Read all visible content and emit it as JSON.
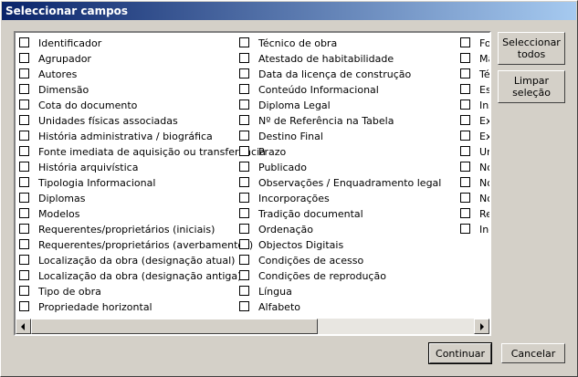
{
  "window": {
    "title": "Seleccionar campos"
  },
  "fields": {
    "col1": [
      "Identificador",
      "Agrupador",
      "Autores",
      "Dimensão",
      "Cota do documento",
      "Unidades físicas associadas",
      "História administrativa / biográfica",
      "Fonte imediata de aquisição ou transferência",
      "História arquivística",
      "Tipologia Informacional",
      "Diplomas",
      "Modelos",
      "Requerentes/proprietários (iniciais)",
      "Requerentes/proprietários (averbamentos)",
      "Localização da obra (designação atual)",
      "Localização da obra (designação antiga)",
      "Tipo de obra",
      "Propriedade horizontal"
    ],
    "col2": [
      "Técnico de obra",
      "Atestado de habitabilidade",
      "Data da licença de construção",
      "Conteúdo Informacional",
      "Diploma Legal",
      "Nº de Referência na Tabela",
      "Destino Final",
      "Prazo",
      "Publicado",
      "Observações / Enquadramento legal",
      "Incorporações",
      "Tradição documental",
      "Ordenação",
      "Objectos Digitais",
      "Condições de acesso",
      "Condições de reprodução",
      "Língua",
      "Alfabeto"
    ],
    "col3": [
      "Fo",
      "Ma",
      "Té",
      "Es",
      "Ins",
      "Ex",
      "Ex",
      "Ur",
      "No",
      "No",
      "No",
      "Re",
      "Inc"
    ]
  },
  "buttons": {
    "select_all": "Seleccionar todos",
    "select_all_line1": "Seleccionar",
    "select_all_line2": "todos",
    "clear": "Limpar seleção",
    "clear_line1": "Limpar",
    "clear_line2": "seleção",
    "continue": "Continuar",
    "cancel": "Cancelar"
  },
  "scrollbar": {
    "left_icon": "arrow-left-icon",
    "right_icon": "arrow-right-icon"
  }
}
